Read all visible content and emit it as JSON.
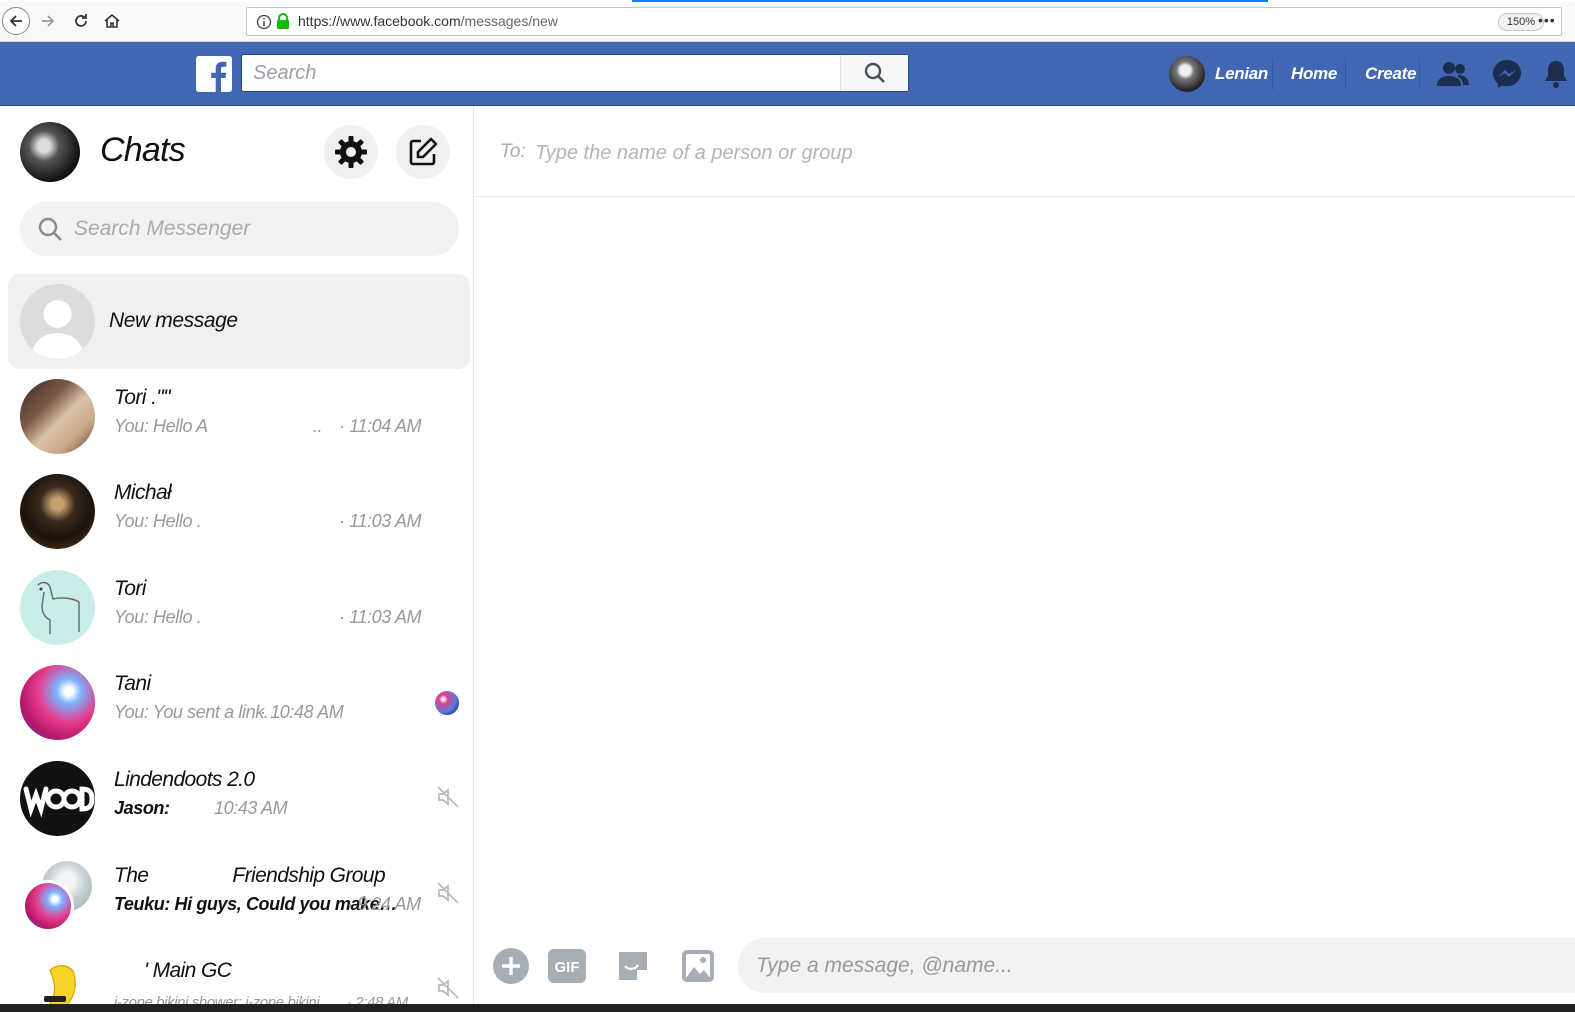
{
  "browser": {
    "url_host": "https://www.facebook.com",
    "url_path": "/messages/new",
    "zoom": "150%",
    "menu_glyph": "•••"
  },
  "fb_header": {
    "search_placeholder": "Search",
    "user_name": "Lenian",
    "home_label": "Home",
    "create_label": "Create",
    "brand_color": "#4267b2"
  },
  "sidebar": {
    "title": "Chats",
    "search_placeholder": "Search Messenger",
    "new_message_label": "New message",
    "chats": [
      {
        "name": "Tori .\"\"",
        "snippet": "You: Hello A",
        "ellipsis": "..",
        "time": "· 11:04 AM",
        "unread": false,
        "indicator": "none"
      },
      {
        "name": "Michał",
        "snippet": "You: Hello .",
        "time": "· 11:03 AM",
        "unread": false,
        "indicator": "none"
      },
      {
        "name": "Tori",
        "snippet": "You: Hello .",
        "time": "· 11:03 AM",
        "unread": false,
        "indicator": "none"
      },
      {
        "name": "Tani",
        "snippet": "You: You sent a link.",
        "time": "· 10:48 AM",
        "unread": false,
        "indicator": "seen-avatar"
      },
      {
        "name": "Lindendoots 2.0",
        "snippet": "Jason:",
        "time": "10:43 AM",
        "unread": true,
        "indicator": "muted"
      },
      {
        "name_prefix": "The",
        "name_suffix": "Friendship Group",
        "snippet": "Teuku: Hi guys, Could you make…",
        "time": "· 9:24 AM",
        "unread": true,
        "indicator": "muted"
      },
      {
        "name": "' Main GC",
        "snippet": "i-zone bikini shower: i-zone bikini...",
        "time": "· 2:48 AM",
        "unread": false,
        "indicator": "muted"
      }
    ]
  },
  "compose": {
    "to_label": "To:",
    "to_placeholder": "Type the name of a person or group",
    "message_placeholder": "Type a message, @name...",
    "gif_label": "GIF"
  }
}
